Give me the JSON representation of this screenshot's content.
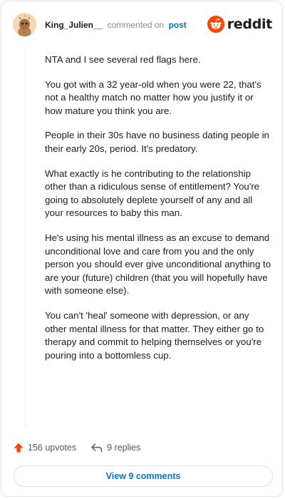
{
  "header": {
    "username": "King_Julien__",
    "action_text": "commented on",
    "link_text": "post",
    "brand": "reddit"
  },
  "comment": {
    "paragraphs": [
      "NTA and I see several red flags here.",
      "You got with a 32 year-old when you were 22, that's not a healthy match no matter how you justify it or how mature you think you are.",
      "People in their 30s have no business dating people in their early 20s, period. It's predatory.",
      "What exactly is he contributing to the relationship other than a ridiculous sense of entitlement? You're going to absolutely deplete yourself of any and all your resources to baby this man.",
      "He's using his mental illness as an excuse to demand unconditional love and care from you and the only person you should ever give unconditional anything to are your (future) children (that you will hopefully have with someone else).",
      "You can't 'heal' someone with depression, or any other mental illness for that matter. They either go to therapy and commit to helping themselves or you're pouring into a bottomless cup."
    ]
  },
  "footer": {
    "upvotes": "156 upvotes",
    "replies": "9 replies",
    "view_comments": "View 9 comments"
  },
  "colors": {
    "accent": "#0079d3",
    "upvote": "#ff4500",
    "muted": "#878a8c"
  },
  "icons": {
    "avatar": "avatar-icon",
    "reddit_logo": "reddit-logo-icon",
    "upvote": "upvote-arrow-icon",
    "reply": "reply-arrow-icon"
  }
}
